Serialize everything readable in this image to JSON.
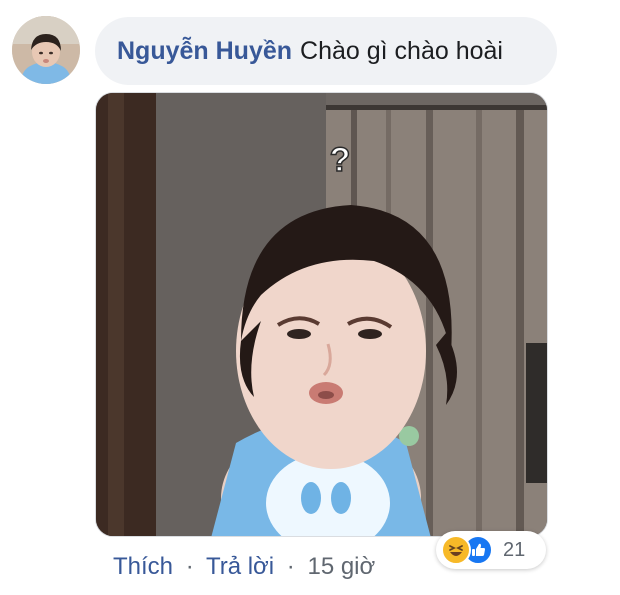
{
  "comment": {
    "author": "Nguyễn Huyền",
    "text": "Chào gì chào hoài"
  },
  "image": {
    "overlay_text": "?"
  },
  "actions": {
    "like_label": "Thích",
    "reply_label": "Trả lời",
    "separator": "·",
    "timestamp": "15 giờ"
  },
  "reactions": {
    "icons": [
      "haha-icon",
      "like-icon"
    ],
    "count": "21"
  },
  "colors": {
    "author": "#385898",
    "bubble_background": "#f0f2f5",
    "meta_text": "#606770",
    "like_blue": "#1877f2",
    "haha_yellow": "#f7b928"
  }
}
